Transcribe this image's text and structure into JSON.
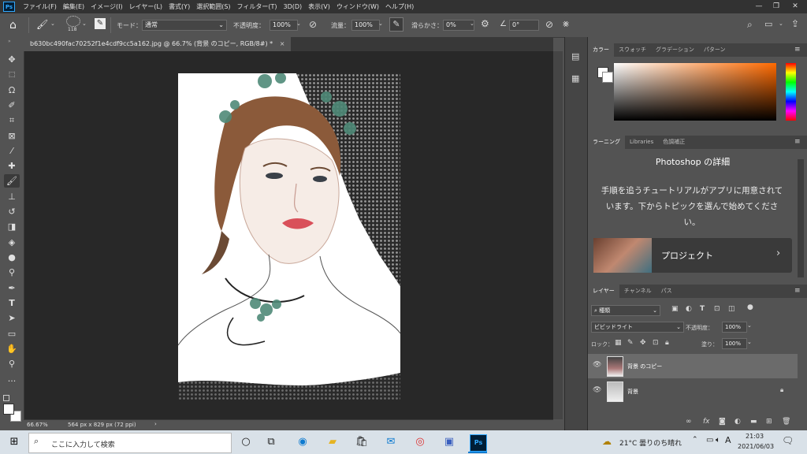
{
  "menubar": {
    "items": [
      "ファイル(F)",
      "編集(E)",
      "イメージ(I)",
      "レイヤー(L)",
      "書式(Y)",
      "選択範囲(S)",
      "フィルター(T)",
      "3D(D)",
      "表示(V)",
      "ウィンドウ(W)",
      "ヘルプ(H)"
    ],
    "logo": "Ps"
  },
  "optbar": {
    "brush_size": "118",
    "mode_label": "モード：",
    "mode_value": "通常",
    "opacity_label": "不透明度：",
    "opacity_value": "100%",
    "flow_label": "流量：",
    "flow_value": "100%",
    "smoothing_label": "滑らかさ：",
    "smoothing_value": "0%",
    "angle_value": "0°"
  },
  "document": {
    "tab_title": "b630bc490fac70252f1e4cdf9cc5a162.jpg @ 66.7% (背景 のコピー, RGB/8#) *",
    "zoom": "66.67%",
    "size_info": "564 px x 829 px (72 ppi)"
  },
  "color_panel": {
    "tabs": [
      "カラー",
      "スウォッチ",
      "グラデーション",
      "パターン"
    ],
    "active_tab": 0
  },
  "learn_panel": {
    "tabs": [
      "ラーニング",
      "Libraries",
      "色調補正"
    ],
    "title": "Photoshop の詳細",
    "body": "手順を追うチュートリアルがアプリに用意されています。下からトピックを選んで始めてください。",
    "card_label": "プロジェクト"
  },
  "layers_panel": {
    "tabs": [
      "レイヤー",
      "チャンネル",
      "パス"
    ],
    "filter_label": "種類",
    "blend_mode": "ビビッドライト",
    "opacity_label": "不透明度：",
    "opacity_value": "100%",
    "lock_label": "ロック：",
    "fill_label": "塗り：",
    "fill_value": "100%",
    "layers": [
      {
        "name": "背景 のコピー",
        "selected": true
      },
      {
        "name": "背景",
        "selected": false,
        "locked": true
      }
    ]
  },
  "taskbar": {
    "search_placeholder": "ここに入力して検索",
    "weather": "21°C 曇りのち晴れ",
    "ime": "A",
    "time": "21:03",
    "date": "2021/06/03"
  },
  "colors": {
    "accent": "#31a8ff",
    "panel_bg": "#535353",
    "canvas_bg": "#282828"
  }
}
